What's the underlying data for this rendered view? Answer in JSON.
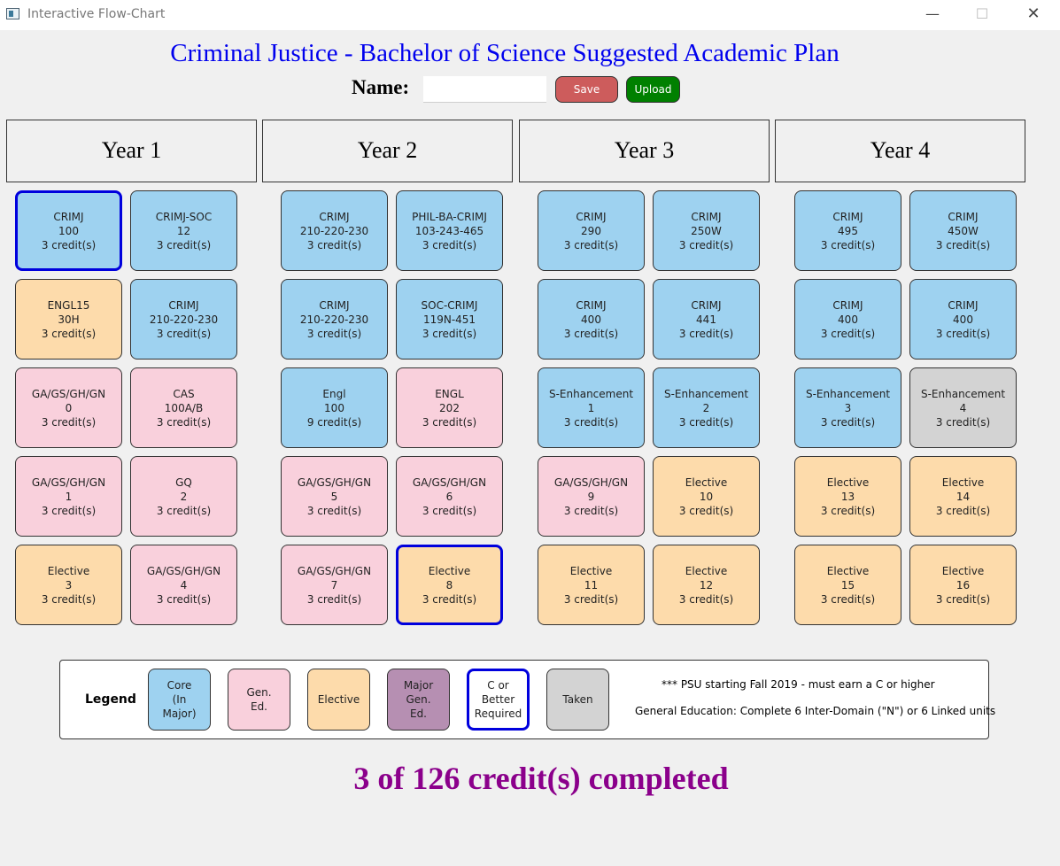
{
  "window": {
    "title": "Interactive Flow-Chart",
    "controls": {
      "minimize": "—",
      "maximize": "☐",
      "close": "✕"
    }
  },
  "page_title": "Criminal Justice - Bachelor of Science Suggested Academic Plan",
  "name_label": "Name:",
  "name_value": "",
  "buttons": {
    "save": "Save",
    "upload": "Upload"
  },
  "years": [
    "Year 1",
    "Year 2",
    "Year 3",
    "Year 4"
  ],
  "courses": [
    [
      {
        "code": "CRIMJ",
        "num": "100",
        "credits": "3 credit(s)",
        "type": "core",
        "c_better": true
      },
      {
        "code": "CRIMJ-SOC",
        "num": "12",
        "credits": "3 credit(s)",
        "type": "core",
        "c_better": false
      },
      {
        "code": "ENGL15",
        "num": "30H",
        "credits": "3 credit(s)",
        "type": "elective",
        "c_better": false
      },
      {
        "code": "CRIMJ",
        "num": "210-220-230",
        "credits": "3 credit(s)",
        "type": "core",
        "c_better": false
      },
      {
        "code": "GA/GS/GH/GN",
        "num": "0",
        "credits": "3 credit(s)",
        "type": "gened",
        "c_better": false
      },
      {
        "code": "CAS",
        "num": "100A/B",
        "credits": "3 credit(s)",
        "type": "gened",
        "c_better": false
      },
      {
        "code": "GA/GS/GH/GN",
        "num": "1",
        "credits": "3 credit(s)",
        "type": "gened",
        "c_better": false
      },
      {
        "code": "GQ",
        "num": "2",
        "credits": "3 credit(s)",
        "type": "gened",
        "c_better": false
      },
      {
        "code": "Elective",
        "num": "3",
        "credits": "3 credit(s)",
        "type": "elective",
        "c_better": false
      },
      {
        "code": "GA/GS/GH/GN",
        "num": "4",
        "credits": "3 credit(s)",
        "type": "gened",
        "c_better": false
      }
    ],
    [
      {
        "code": "CRIMJ",
        "num": "210-220-230",
        "credits": "3 credit(s)",
        "type": "core",
        "c_better": false
      },
      {
        "code": "PHIL-BA-CRIMJ",
        "num": "103-243-465",
        "credits": "3 credit(s)",
        "type": "core",
        "c_better": false
      },
      {
        "code": "CRIMJ",
        "num": "210-220-230",
        "credits": "3 credit(s)",
        "type": "core",
        "c_better": false
      },
      {
        "code": "SOC-CRIMJ",
        "num": "119N-451",
        "credits": "3 credit(s)",
        "type": "core",
        "c_better": false
      },
      {
        "code": "Engl",
        "num": "100",
        "credits": "9 credit(s)",
        "type": "core",
        "c_better": false
      },
      {
        "code": "ENGL",
        "num": "202",
        "credits": "3 credit(s)",
        "type": "gened",
        "c_better": false
      },
      {
        "code": "GA/GS/GH/GN",
        "num": "5",
        "credits": "3 credit(s)",
        "type": "gened",
        "c_better": false
      },
      {
        "code": "GA/GS/GH/GN",
        "num": "6",
        "credits": "3 credit(s)",
        "type": "gened",
        "c_better": false
      },
      {
        "code": "GA/GS/GH/GN",
        "num": "7",
        "credits": "3 credit(s)",
        "type": "gened",
        "c_better": false
      },
      {
        "code": "Elective",
        "num": "8",
        "credits": "3 credit(s)",
        "type": "elective",
        "c_better": true
      }
    ],
    [
      {
        "code": "CRIMJ",
        "num": "290",
        "credits": "3 credit(s)",
        "type": "core",
        "c_better": false
      },
      {
        "code": "CRIMJ",
        "num": "250W",
        "credits": "3 credit(s)",
        "type": "core",
        "c_better": false
      },
      {
        "code": "CRIMJ",
        "num": "400",
        "credits": "3 credit(s)",
        "type": "core",
        "c_better": false
      },
      {
        "code": "CRIMJ",
        "num": "441",
        "credits": "3 credit(s)",
        "type": "core",
        "c_better": false
      },
      {
        "code": "S-Enhancement",
        "num": "1",
        "credits": "3 credit(s)",
        "type": "core",
        "c_better": false
      },
      {
        "code": "S-Enhancement",
        "num": "2",
        "credits": "3 credit(s)",
        "type": "core",
        "c_better": false
      },
      {
        "code": "GA/GS/GH/GN",
        "num": "9",
        "credits": "3 credit(s)",
        "type": "gened",
        "c_better": false
      },
      {
        "code": "Elective",
        "num": "10",
        "credits": "3 credit(s)",
        "type": "elective",
        "c_better": false
      },
      {
        "code": "Elective",
        "num": "11",
        "credits": "3 credit(s)",
        "type": "elective",
        "c_better": false
      },
      {
        "code": "Elective",
        "num": "12",
        "credits": "3 credit(s)",
        "type": "elective",
        "c_better": false
      }
    ],
    [
      {
        "code": "CRIMJ",
        "num": "495",
        "credits": "3 credit(s)",
        "type": "core",
        "c_better": false
      },
      {
        "code": "CRIMJ",
        "num": "450W",
        "credits": "3 credit(s)",
        "type": "core",
        "c_better": false
      },
      {
        "code": "CRIMJ",
        "num": "400",
        "credits": "3 credit(s)",
        "type": "core",
        "c_better": false
      },
      {
        "code": "CRIMJ",
        "num": "400",
        "credits": "3 credit(s)",
        "type": "core",
        "c_better": false
      },
      {
        "code": "S-Enhancement",
        "num": "3",
        "credits": "3 credit(s)",
        "type": "core",
        "c_better": false
      },
      {
        "code": "S-Enhancement",
        "num": "4",
        "credits": "3 credit(s)",
        "type": "taken",
        "c_better": false
      },
      {
        "code": "Elective",
        "num": "13",
        "credits": "3 credit(s)",
        "type": "elective",
        "c_better": false
      },
      {
        "code": "Elective",
        "num": "14",
        "credits": "3 credit(s)",
        "type": "elective",
        "c_better": false
      },
      {
        "code": "Elective",
        "num": "15",
        "credits": "3 credit(s)",
        "type": "elective",
        "c_better": false
      },
      {
        "code": "Elective",
        "num": "16",
        "credits": "3 credit(s)",
        "type": "elective",
        "c_better": false
      }
    ]
  ],
  "legend": {
    "title": "Legend",
    "items": [
      {
        "label": "Core\n(In\nMajor)",
        "type": "core"
      },
      {
        "label": "Gen.\nEd.",
        "type": "gened"
      },
      {
        "label": "Elective",
        "type": "elective"
      },
      {
        "label": "Major\nGen.\nEd.",
        "type": "major"
      },
      {
        "label": "C or\nBetter\nRequired",
        "type": "cbetter"
      },
      {
        "label": "Taken",
        "type": "taken"
      }
    ],
    "note1": "*** PSU starting Fall 2019 - must earn a C or higher",
    "note2": "General Education: Complete 6 Inter-Domain (\"N\") or 6 Linked units"
  },
  "colors": {
    "core": "#9ed2f0",
    "gened": "#f9d0dc",
    "elective": "#fddbab",
    "major_gened": "#b68fb2",
    "taken": "#d3d3d3",
    "c_better_border": "#0000dd",
    "title": "#0000ee",
    "completed": "#8b008b",
    "save": "#cd5c5c",
    "upload": "#008000"
  },
  "completed": "3 of 126 credit(s) completed"
}
